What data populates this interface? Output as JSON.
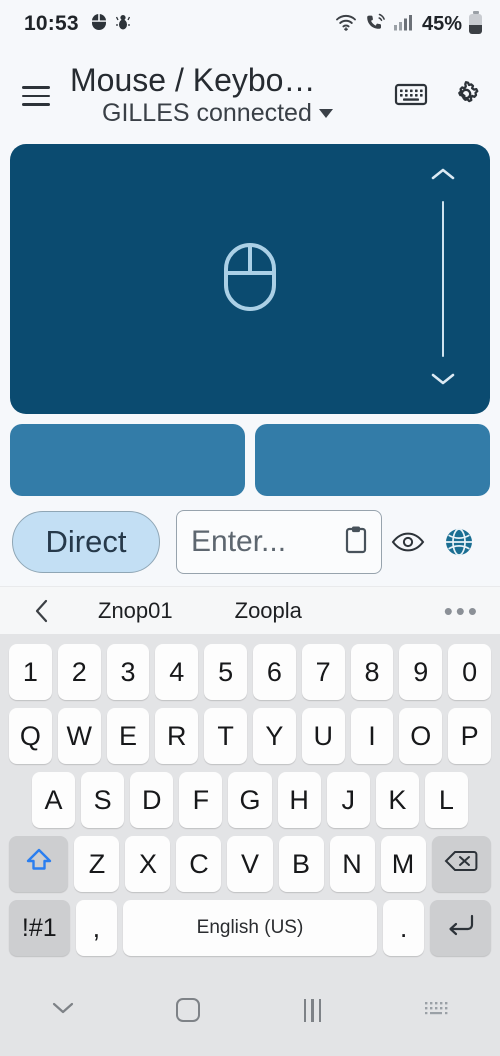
{
  "status_bar": {
    "time": "10:53",
    "left_icons": [
      "mouse-icon",
      "ant-icon"
    ],
    "right_icons": [
      "wifi-icon",
      "call-icon",
      "signal-icon"
    ],
    "battery_percent": "45%"
  },
  "app_bar": {
    "menu_icon": "hamburger-icon",
    "title": "Mouse / Keybo…",
    "subtitle": "GILLES connected",
    "keyboard_icon": "keyboard-icon",
    "settings_icon": "gear-icon"
  },
  "trackpad": {
    "icon": "mouse-icon",
    "scroll_up_icon": "chevron-up-icon",
    "scroll_down_icon": "chevron-down-icon"
  },
  "mouse_buttons": [
    {
      "name": "left-click-button"
    },
    {
      "name": "right-click-button"
    }
  ],
  "input_row": {
    "mode_chip_label": "Direct",
    "text_placeholder": "Enter...",
    "paste_icon": "clipboard-icon",
    "eye_icon": "eye-icon",
    "globe_icon": "globe-icon"
  },
  "suggestions": {
    "back_icon": "chevron-left-icon",
    "words": [
      "Znop01",
      "Zoopla"
    ],
    "more_icon": "more-horizontal-icon"
  },
  "keyboard": {
    "row_numbers": [
      "1",
      "2",
      "3",
      "4",
      "5",
      "6",
      "7",
      "8",
      "9",
      "0"
    ],
    "row_top": [
      "Q",
      "W",
      "E",
      "R",
      "T",
      "Y",
      "U",
      "I",
      "O",
      "P"
    ],
    "row_home": [
      "A",
      "S",
      "D",
      "F",
      "G",
      "H",
      "J",
      "K",
      "L"
    ],
    "row_bottom": [
      "Z",
      "X",
      "C",
      "V",
      "B",
      "N",
      "M"
    ],
    "shift_icon": "shift-icon",
    "backspace_icon": "backspace-icon",
    "symbols_label": "!#1",
    "comma_label": ",",
    "space_label": "English (US)",
    "period_label": ".",
    "enter_icon": "enter-icon"
  },
  "nav_bar": {
    "hide_keyboard_icon": "chevron-down-icon",
    "home_icon": "home-icon",
    "recents_icon": "recents-icon",
    "keyboard_switch_icon": "keyboard-switch-icon"
  },
  "colors": {
    "background": "#f6f8fb",
    "trackpad": "#0b4b70",
    "mouse_button": "#337ca8",
    "chip_fill": "#c3dff4",
    "globe": "#1a6e92",
    "shift_accent": "#2a7ef0",
    "keyboard_bg": "#e3e4e6"
  }
}
